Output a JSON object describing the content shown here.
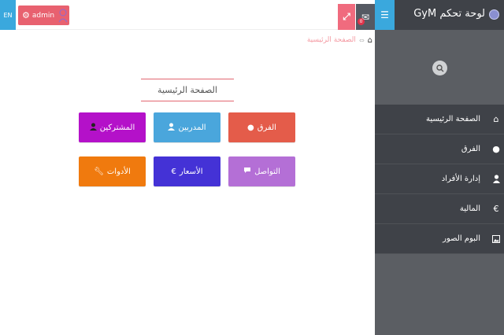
{
  "topbar": {
    "lang_label": "EN",
    "admin_label": "admin",
    "mail_badge": "0"
  },
  "breadcrumb": {
    "current": "الصفحة الرئيسية"
  },
  "main": {
    "title": "الصفحة الرئيسية",
    "tiles": [
      {
        "label": "الفرق",
        "icon": "globe-icon",
        "color": "#e45c4a"
      },
      {
        "label": "المدربين",
        "icon": "user-icon",
        "color": "#4aa6dc"
      },
      {
        "label": "المشتركين",
        "icon": "user-icon",
        "color": "#b411c9"
      },
      {
        "label": "التواصل",
        "icon": "comment-icon",
        "color": "#b46fd6"
      },
      {
        "label": "الأسعار",
        "icon": "euro-icon",
        "color": "#4432d6"
      },
      {
        "label": "الأدوات",
        "icon": "wrench-icon",
        "color": "#f07a0e"
      }
    ]
  },
  "sidebar": {
    "brand": "لوحة تحكم GyM",
    "items": [
      {
        "label": "الصفحة الرئيسية",
        "icon": "home-icon"
      },
      {
        "label": "الفرق",
        "icon": "globe-icon"
      },
      {
        "label": "إدارة الأفراد",
        "icon": "user-icon"
      },
      {
        "label": "المالية",
        "icon": "euro-icon"
      },
      {
        "label": "البوم الصور",
        "icon": "image-icon"
      }
    ]
  },
  "colors": {
    "accent_blue": "#3aa8dd",
    "accent_pink": "#e8616f",
    "sidebar_bg": "#5b5e63",
    "sidebar_dark": "#3f4248"
  }
}
